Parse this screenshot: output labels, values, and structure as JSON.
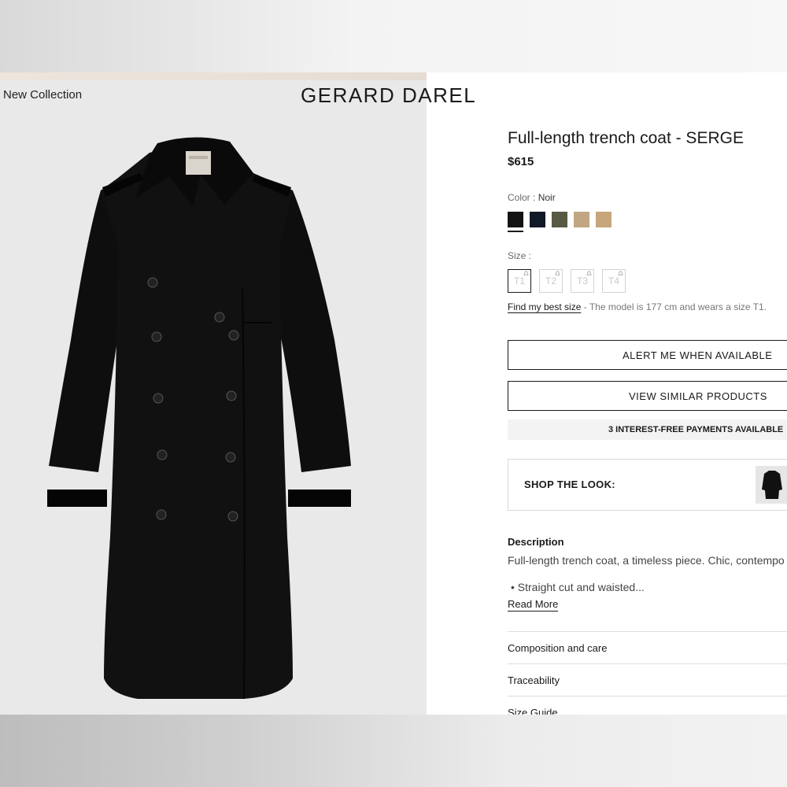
{
  "header": {
    "breadcrumb": "New Collection",
    "brand": "GERARD DAREL"
  },
  "product": {
    "title": "Full-length trench coat - SERGE",
    "price": "$615",
    "color_label": "Color :",
    "color_value": "Noir",
    "swatches": [
      {
        "name": "Noir",
        "color": "#141414",
        "selected": true
      },
      {
        "name": "Navy",
        "color": "#111827"
      },
      {
        "name": "Olive",
        "color": "#585b43"
      },
      {
        "name": "Beige",
        "color": "#c2a684"
      },
      {
        "name": "Camel",
        "color": "#c7a67c"
      }
    ],
    "size_label": "Size :",
    "sizes": [
      {
        "label": "T1",
        "selected": true
      },
      {
        "label": "T2"
      },
      {
        "label": "T3"
      },
      {
        "label": "T4"
      }
    ],
    "fit_link": "Find my best size",
    "fit_note": " - The model is 177 cm and wears a size T1."
  },
  "actions": {
    "alert_label": "ALERT ME WHEN AVAILABLE",
    "similar_label": "VIEW SIMILAR PRODUCTS",
    "payments": "3 INTEREST-FREE PAYMENTS AVAILABLE"
  },
  "shop_the_look": {
    "label": "SHOP THE LOOK:"
  },
  "description": {
    "heading": "Description",
    "text": "Full-length trench coat, a timeless piece. Chic, contempo",
    "bullet": "• Straight cut and waisted...",
    "read_more": "Read More"
  },
  "accordions": [
    {
      "label": "Composition and care"
    },
    {
      "label": "Traceability"
    },
    {
      "label": "Size Guide"
    }
  ],
  "icons": {
    "size_alert": "bell-icon",
    "product_image": "trench-coat-image"
  }
}
